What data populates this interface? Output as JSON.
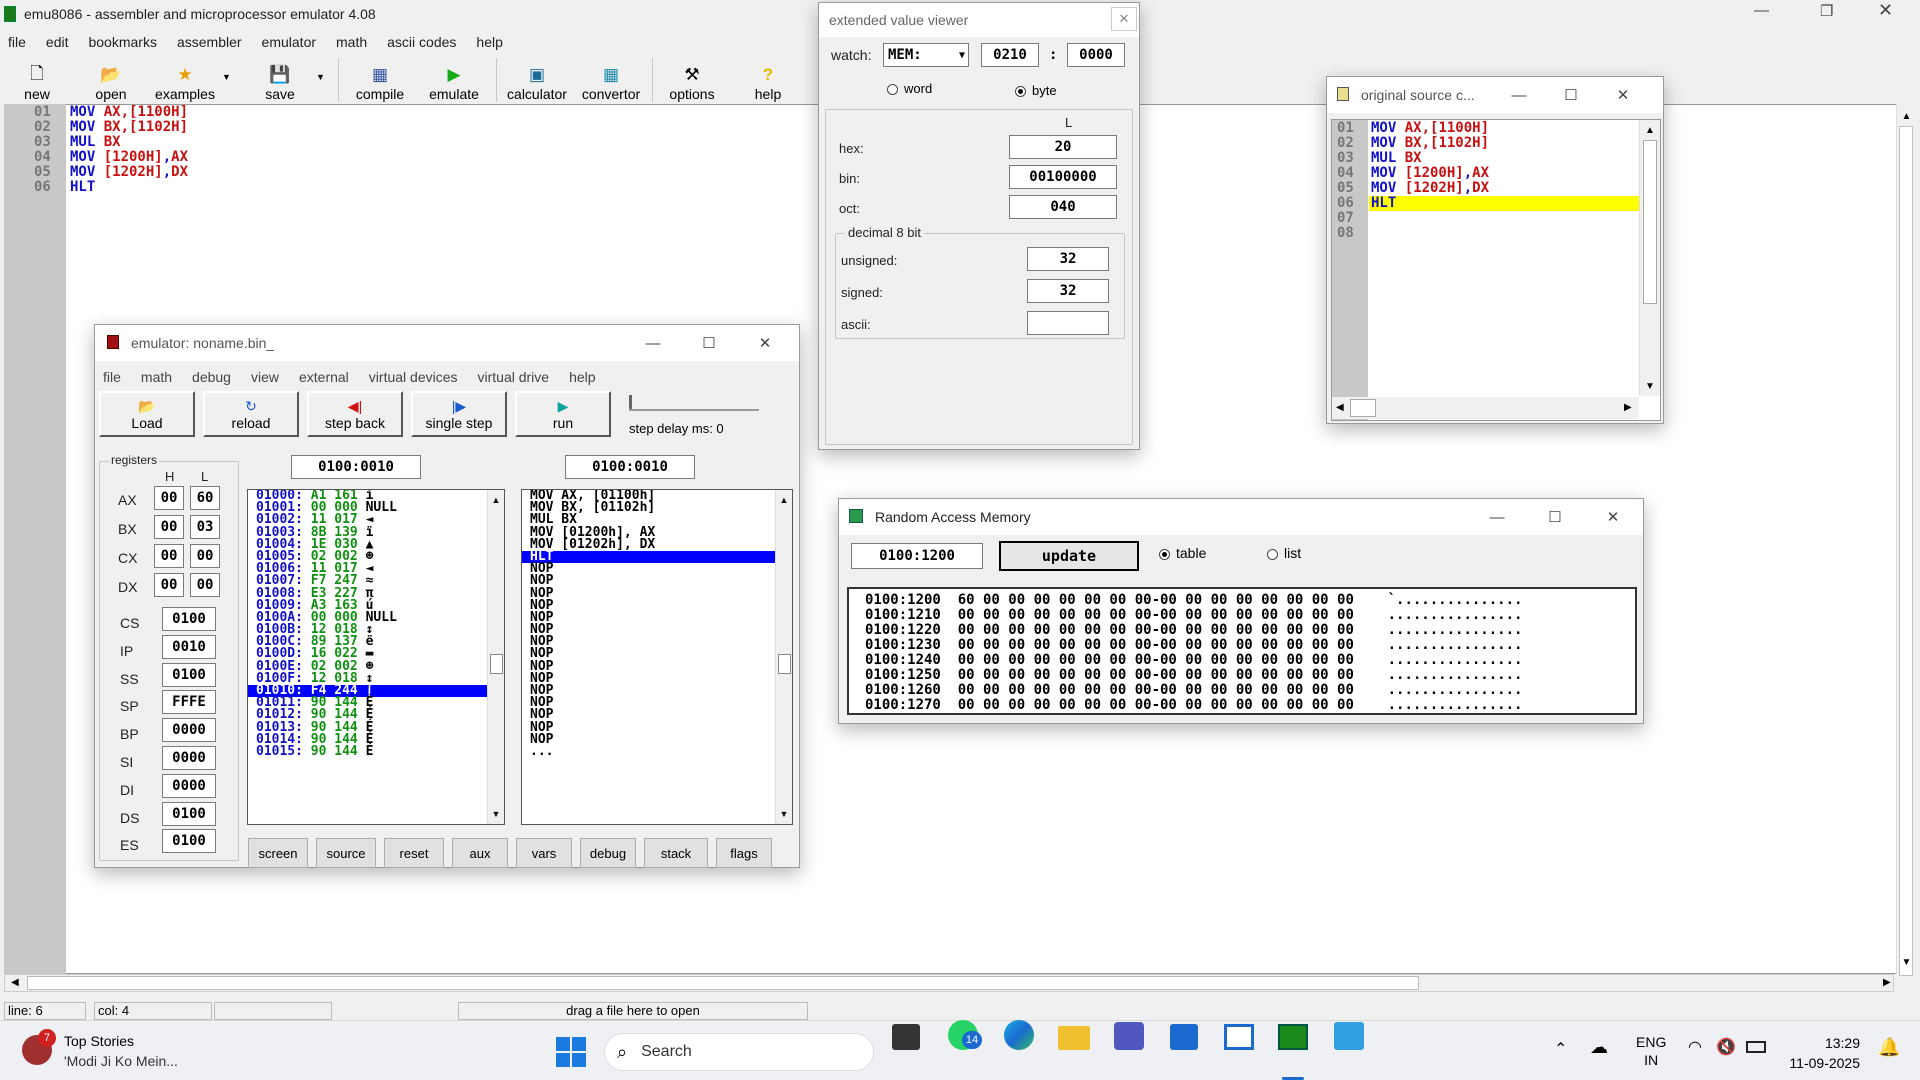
{
  "main": {
    "title": "emu8086 - assembler and microprocessor emulator 4.08",
    "menu": [
      "file",
      "edit",
      "bookmarks",
      "assembler",
      "emulator",
      "math",
      "ascii codes",
      "help"
    ],
    "toolbar": {
      "new": "new",
      "open": "open",
      "examples": "examples",
      "save": "save",
      "compile": "compile",
      "emulate": "emulate",
      "calculator": "calculator",
      "convertor": "convertor",
      "options": "options",
      "help": "help"
    },
    "linenos": [
      "01",
      "02",
      "03",
      "04",
      "05",
      "06"
    ],
    "code": [
      [
        "MOV",
        "AX,",
        "[1100H]",
        ""
      ],
      [
        "MOV",
        "BX,",
        "[1102H]",
        ""
      ],
      [
        "MUL",
        "BX",
        "",
        ""
      ],
      [
        "MOV",
        "[1200H]",
        ",",
        "AX"
      ],
      [
        "MOV",
        "[1202H]",
        ",",
        "DX"
      ],
      [
        "HLT",
        "",
        "",
        ""
      ]
    ],
    "status": {
      "line": "line: 6",
      "col": "col: 4",
      "hint": "drag a file here to open"
    }
  },
  "viewer": {
    "title": "extended value viewer",
    "watch": "watch:",
    "mem": "MEM:",
    "seg": "0210",
    "colon": ":",
    "off": "0000",
    "word": "word",
    "byte": "byte",
    "col": "L",
    "hex_l": "hex:",
    "hex": "20",
    "bin_l": "bin:",
    "bin": "00100000",
    "oct_l": "oct:",
    "oct": "040",
    "group": "decimal 8 bit",
    "uns_l": "unsigned:",
    "uns": "32",
    "sig_l": "signed:",
    "sig": "32",
    "asc_l": "ascii:",
    "asc": ""
  },
  "source": {
    "title": "original source c...",
    "linenos": [
      "01",
      "02",
      "03",
      "04",
      "05",
      "06",
      "07",
      "08"
    ],
    "code": [
      [
        "MOV",
        "AX,",
        "[1100H]",
        ""
      ],
      [
        "MOV",
        "BX,",
        "[1102H]",
        ""
      ],
      [
        "MUL",
        "BX",
        "",
        ""
      ],
      [
        "MOV",
        "[1200H]",
        ",",
        "AX"
      ],
      [
        "MOV",
        "[1202H]",
        ",",
        "DX"
      ],
      [
        "HLT",
        "",
        "",
        ""
      ],
      [
        "",
        "",
        "",
        ""
      ],
      [
        "",
        "",
        "",
        ""
      ]
    ]
  },
  "emu": {
    "title": "emulator: noname.bin_",
    "menu": [
      "file",
      "math",
      "debug",
      "view",
      "external",
      "virtual devices",
      "virtual drive",
      "help"
    ],
    "btns": {
      "load": "Load",
      "reload": "reload",
      "stepback": "step back",
      "single": "single step",
      "run": "run",
      "delay": "step delay ms: 0"
    },
    "regs_title": "registers",
    "h": "H",
    "l": "L",
    "regs8": [
      [
        "AX",
        "00",
        "60"
      ],
      [
        "BX",
        "00",
        "03"
      ],
      [
        "CX",
        "00",
        "00"
      ],
      [
        "DX",
        "00",
        "00"
      ]
    ],
    "regs16": [
      [
        "CS",
        "0100"
      ],
      [
        "IP",
        "0010"
      ],
      [
        "SS",
        "0100"
      ],
      [
        "SP",
        "FFFE"
      ],
      [
        "BP",
        "0000"
      ],
      [
        "SI",
        "0000"
      ],
      [
        "DI",
        "0000"
      ],
      [
        "DS",
        "0100"
      ],
      [
        "ES",
        "0100"
      ]
    ],
    "addr1": "0100:0010",
    "addr2": "0100:0010",
    "mem": [
      [
        "01000:",
        "A1",
        "161",
        "í"
      ],
      [
        "01001:",
        "00",
        "000",
        "NULL"
      ],
      [
        "01002:",
        "11",
        "017",
        "◄"
      ],
      [
        "01003:",
        "8B",
        "139",
        "ï"
      ],
      [
        "01004:",
        "1E",
        "030",
        "▲"
      ],
      [
        "01005:",
        "02",
        "002",
        "☻"
      ],
      [
        "01006:",
        "11",
        "017",
        "◄"
      ],
      [
        "01007:",
        "F7",
        "247",
        "≈"
      ],
      [
        "01008:",
        "E3",
        "227",
        "π"
      ],
      [
        "01009:",
        "A3",
        "163",
        "ú"
      ],
      [
        "0100A:",
        "00",
        "000",
        "NULL"
      ],
      [
        "0100B:",
        "12",
        "018",
        "↕"
      ],
      [
        "0100C:",
        "89",
        "137",
        "ë"
      ],
      [
        "0100D:",
        "16",
        "022",
        "▬"
      ],
      [
        "0100E:",
        "02",
        "002",
        "☻"
      ],
      [
        "0100F:",
        "12",
        "018",
        "↕"
      ],
      [
        "01010:",
        "F4",
        "244",
        "⌠"
      ],
      [
        "01011:",
        "90",
        "144",
        "É"
      ],
      [
        "01012:",
        "90",
        "144",
        "É"
      ],
      [
        "01013:",
        "90",
        "144",
        "É"
      ],
      [
        "01014:",
        "90",
        "144",
        "É"
      ],
      [
        "01015:",
        "90",
        "144",
        "É"
      ]
    ],
    "dis": [
      "MOV AX, [01100h]",
      "MOV BX, [01102h]",
      "MUL BX",
      "MOV [01200h], AX",
      "MOV [01202h], DX",
      "HLT",
      "NOP",
      "NOP",
      "NOP",
      "NOP",
      "NOP",
      "NOP",
      "NOP",
      "NOP",
      "NOP",
      "NOP",
      "NOP",
      "NOP",
      "NOP",
      "NOP",
      "NOP",
      "..."
    ],
    "bottom": [
      "screen",
      "source",
      "reset",
      "aux",
      "vars",
      "debug",
      "stack",
      "flags"
    ]
  },
  "ram": {
    "title": "Random Access Memory",
    "addr": "0100:1200",
    "update": "update",
    "table": "table",
    "list": "list",
    "rows": [
      [
        "0100:1200",
        "60 00 00 00 00 00 00 00-00 00 00 00 00 00 00 00",
        "`..............."
      ],
      [
        "0100:1210",
        "00 00 00 00 00 00 00 00-00 00 00 00 00 00 00 00",
        "................"
      ],
      [
        "0100:1220",
        "00 00 00 00 00 00 00 00-00 00 00 00 00 00 00 00",
        "................"
      ],
      [
        "0100:1230",
        "00 00 00 00 00 00 00 00-00 00 00 00 00 00 00 00",
        "................"
      ],
      [
        "0100:1240",
        "00 00 00 00 00 00 00 00-00 00 00 00 00 00 00 00",
        "................"
      ],
      [
        "0100:1250",
        "00 00 00 00 00 00 00 00-00 00 00 00 00 00 00 00",
        "................"
      ],
      [
        "0100:1260",
        "00 00 00 00 00 00 00 00-00 00 00 00 00 00 00 00",
        "................"
      ],
      [
        "0100:1270",
        "00 00 00 00 00 00 00 00-00 00 00 00 00 00 00 00",
        "................"
      ]
    ]
  },
  "taskbar": {
    "badge": "7",
    "news1": "Top Stories",
    "news2": "'Modi Ji Ko Mein...",
    "search": "Search",
    "wa_badge": "14",
    "lang1": "ENG",
    "lang2": "IN",
    "time": "13:29",
    "date": "11-09-2025"
  }
}
